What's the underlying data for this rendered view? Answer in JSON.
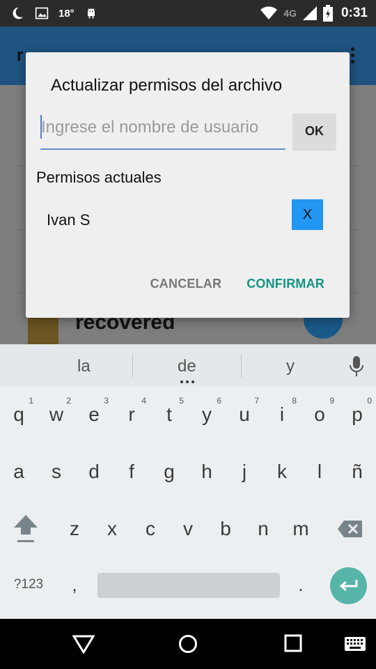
{
  "status_bar": {
    "temperature": "18°",
    "network": "4G",
    "time": "0:31",
    "icons": [
      "moon-icon",
      "image-icon",
      "android-icon",
      "wifi-icon",
      "signal-icon",
      "battery-icon"
    ]
  },
  "background": {
    "title": "r",
    "list_item": "recovered"
  },
  "dialog": {
    "title": "Actualizar permisos del archivo",
    "input_placeholder": "Ingrese el nombre de usuario",
    "input_value": "",
    "ok_label": "OK",
    "permissions_heading": "Permisos actuales",
    "permissions": [
      {
        "user": "Ivan S",
        "remove_label": "X"
      }
    ],
    "cancel_label": "CANCELAR",
    "confirm_label": "CONFIRMAR",
    "accent_color": "#149484",
    "remove_color": "#2196f3"
  },
  "keyboard": {
    "suggestions": [
      "la",
      "de",
      "y"
    ],
    "row1": [
      "q",
      "w",
      "e",
      "r",
      "t",
      "y",
      "u",
      "i",
      "o",
      "p"
    ],
    "row1_hints": [
      "1",
      "2",
      "3",
      "4",
      "5",
      "6",
      "7",
      "8",
      "9",
      "0"
    ],
    "row2": [
      "a",
      "s",
      "d",
      "f",
      "g",
      "h",
      "j",
      "k",
      "l",
      "ñ"
    ],
    "row3": [
      "z",
      "x",
      "c",
      "v",
      "b",
      "n",
      "m"
    ],
    "symbols_label": "?123",
    "comma": ",",
    "period": ".",
    "enter_color": "#56b4a8"
  }
}
